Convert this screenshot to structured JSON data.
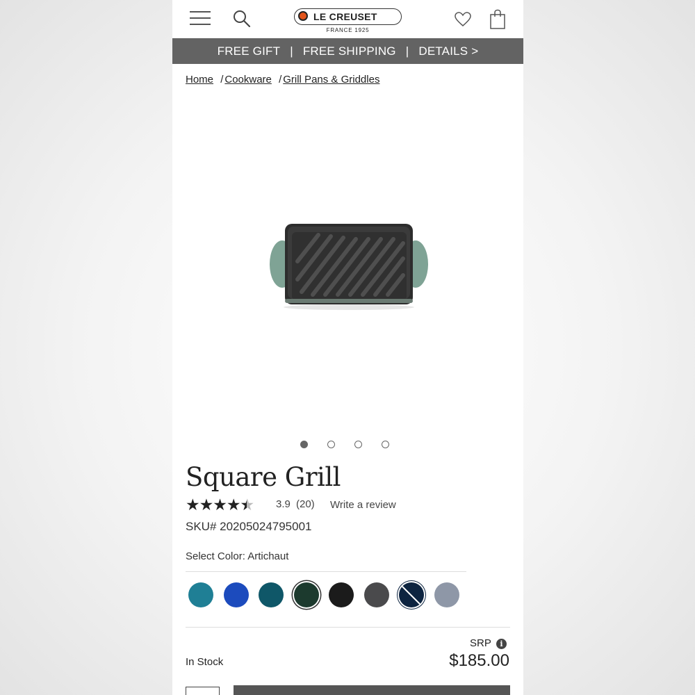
{
  "header": {
    "logo": {
      "name": "LE CREUSET",
      "tagline": "FRANCE 1925"
    },
    "icons": {
      "menu": "hamburger-icon",
      "search": "search-icon",
      "wishlist": "heart-icon",
      "bag": "shopping-bag-icon"
    }
  },
  "promo": {
    "items": [
      "FREE GIFT",
      "FREE SHIPPING",
      "DETAILS >"
    ],
    "separator": "|"
  },
  "breadcrumb": [
    "Home",
    "Cookware",
    "Grill Pans & Griddles"
  ],
  "breadcrumb_separator": "/",
  "gallery": {
    "image_count": 4,
    "active_index": 0
  },
  "product": {
    "title": "Square Grill",
    "rating": 3.9,
    "rating_display": "3.9",
    "review_count": "(20)",
    "stars_filled": 4,
    "write_review": "Write a review",
    "sku": "SKU# 20205024795001",
    "color_label": "Select Color: Artichaut",
    "selected_color_index": 3,
    "colors": [
      {
        "name": "teal",
        "hex": "#1f7f95"
      },
      {
        "name": "blue",
        "hex": "#1c4bbd"
      },
      {
        "name": "deep-teal",
        "hex": "#0f5768"
      },
      {
        "name": "artichaut",
        "hex": "#1c3a2e"
      },
      {
        "name": "black",
        "hex": "#1b1b1b"
      },
      {
        "name": "graphite",
        "hex": "#4a4a4c"
      },
      {
        "name": "navy",
        "hex": "#0d2440"
      },
      {
        "name": "grey-blue",
        "hex": "#8e97a7"
      }
    ],
    "srp_label": "SRP",
    "availability": "In Stock",
    "price": "$185.00"
  },
  "colors": {
    "promo_bar": "#636363",
    "handle_green": "#7fa395",
    "pan_dark": "#333333"
  }
}
